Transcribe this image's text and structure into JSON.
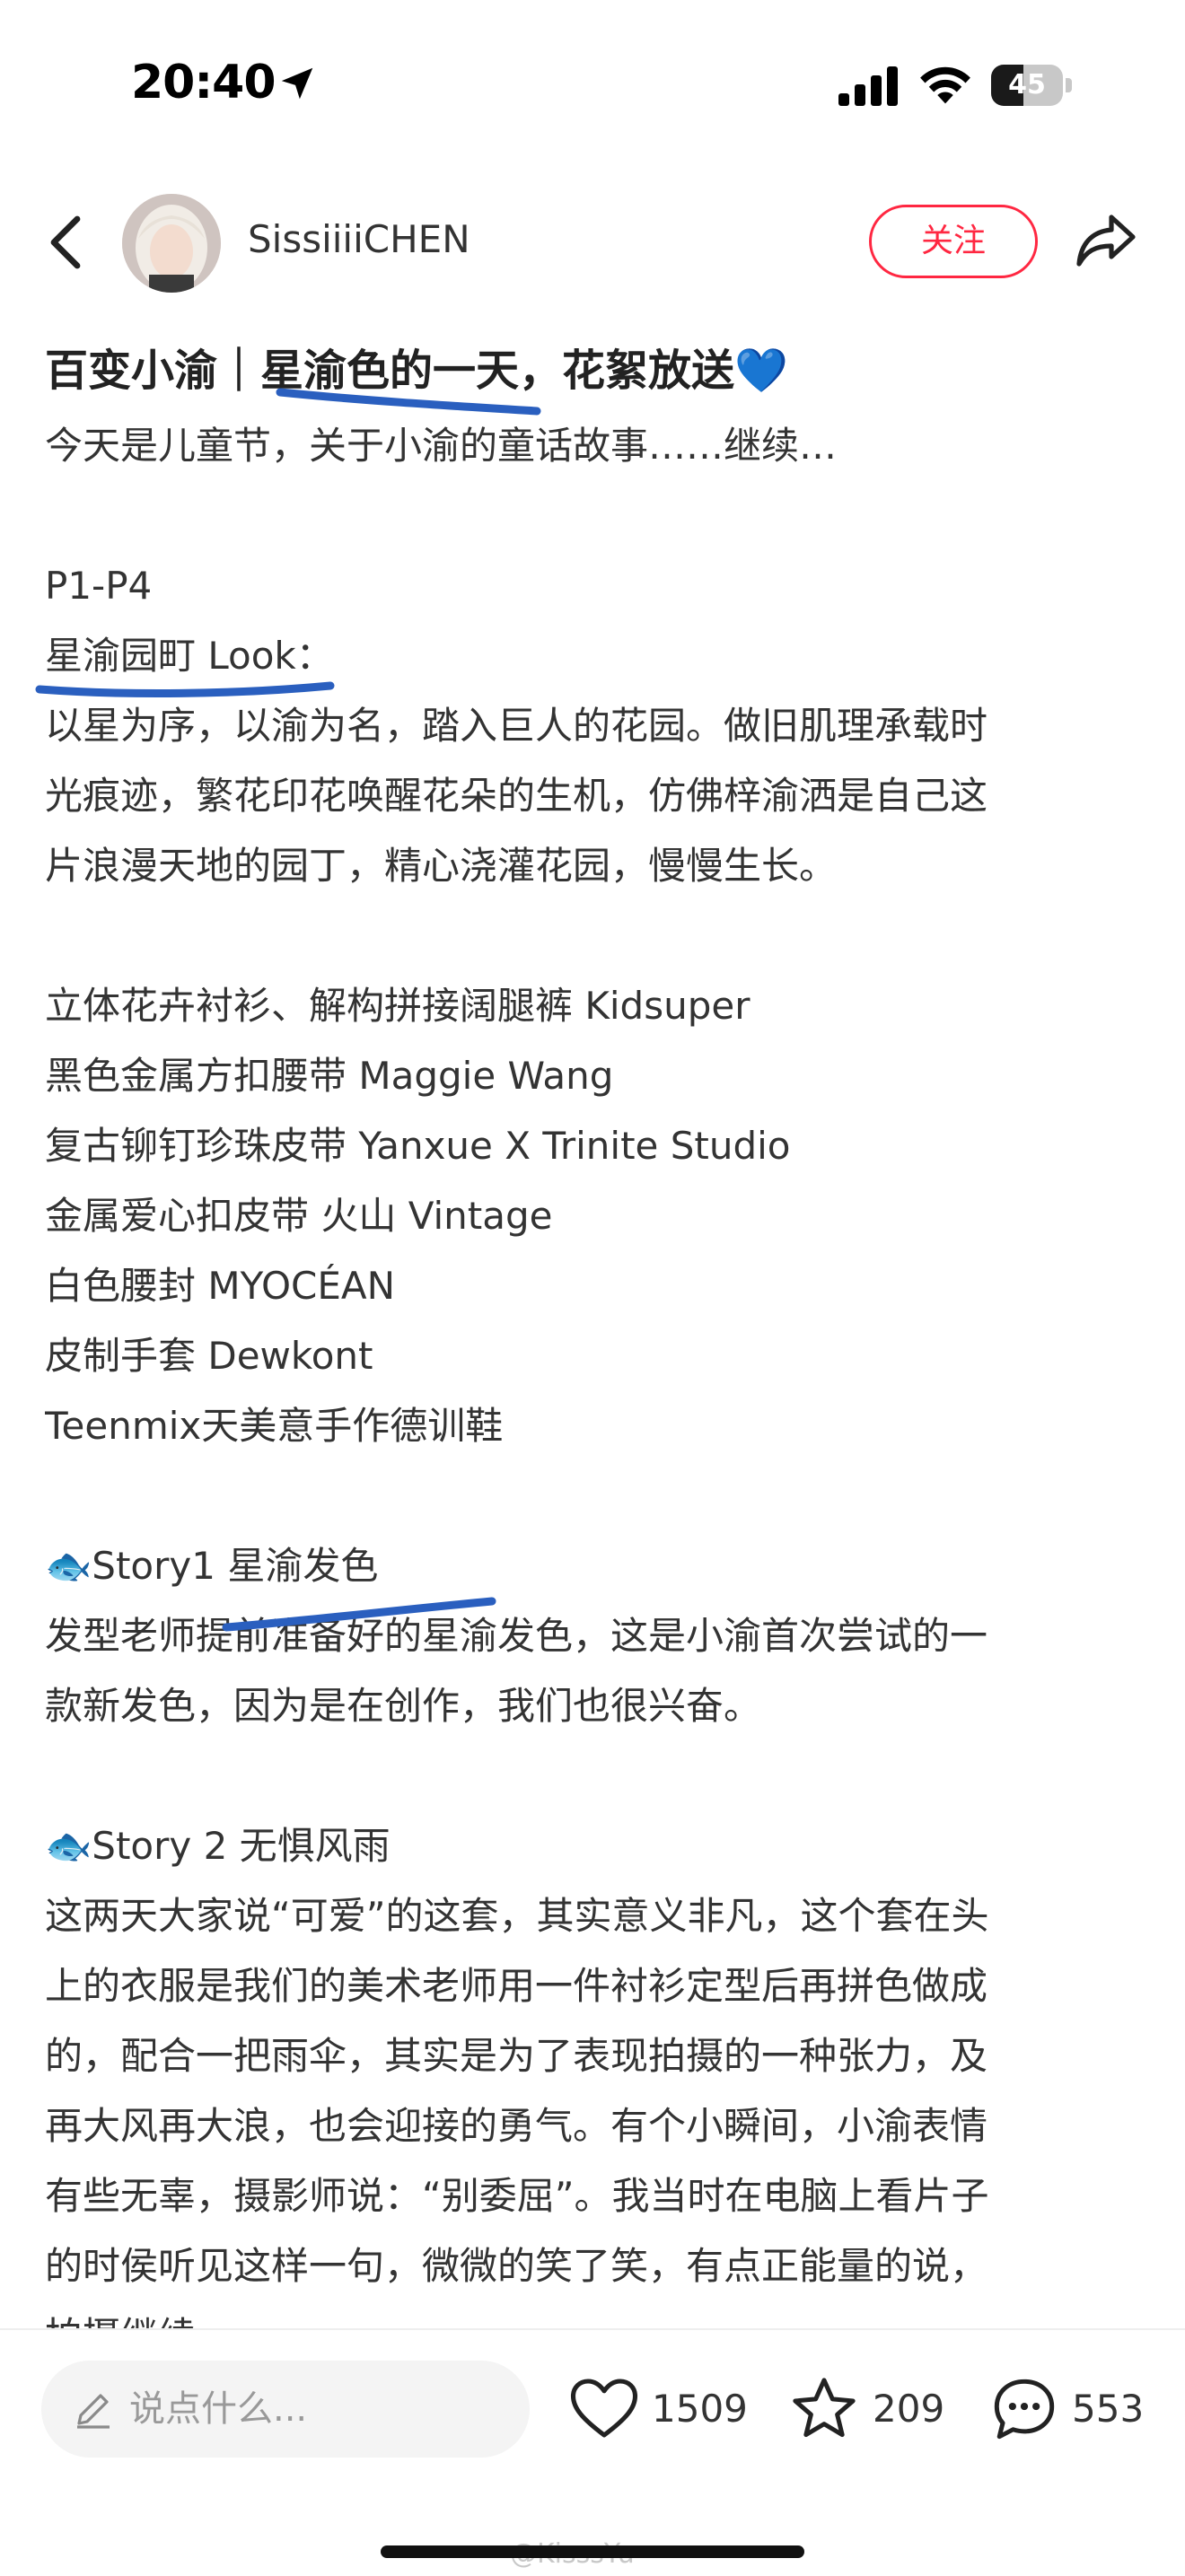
{
  "status_bar": {
    "time": "20:40",
    "battery": "45",
    "battery_level": 0.45
  },
  "header": {
    "username": "SissiiiiCHEN",
    "follow_label": "关注"
  },
  "post": {
    "title": "百变小渝｜星渝色的一天，花絮放送💙",
    "lines": [
      "今天是儿童节，关于小渝的童话故事……继续…",
      "",
      "P1-P4",
      "星渝园町 Look：",
      "以星为序，以渝为名，踏入巨人的花园。做旧肌理承载时",
      "光痕迹，繁花印花唤醒花朵的生机，仿佛梓渝洒是自己这",
      "片浪漫天地的园丁，精心浇灌花园，慢慢生长。",
      "",
      "立体花卉衬衫、解构拼接阔腿裤 Kidsuper",
      "黑色金属方扣腰带 Maggie Wang",
      "复古铆钉珍珠皮带 Yanxue X Trinite Studio",
      "金属爱心扣皮带 火山 Vintage",
      "白色腰封 MYOCÉAN",
      "皮制手套 Dewkont",
      "Teenmix天美意手作德训鞋",
      "",
      "🐟Story1 星渝发色",
      "发型老师提前准备好的星渝发色，这是小渝首次尝试的一",
      "款新发色，因为是在创作，我们也很兴奋。",
      "",
      "🐟Story 2 无惧风雨",
      "这两天大家说“可爱”的这套，其实意义非凡，这个套在头",
      "上的衣服是我们的美术老师用一件衬衫定型后再拼色做成",
      "的，配合一把雨伞，其实是为了表现拍摄的一种张力，及",
      "再大风再大浪，也会迎接的勇气。有个小瞬间，小渝表情",
      "有些无辜，摄影师说：“别委屈”。我当时在电脑上看片子",
      "的时侯听见这样一句，微微的笑了笑，有点正能量的说，",
      "拍摄继续"
    ]
  },
  "bottom_bar": {
    "comment_placeholder": "说点什么...",
    "likes": "1509",
    "collects": "209",
    "comments": "553",
    "watermark": "@KisssYu"
  },
  "colors": {
    "accent": "#ff2741",
    "annotation": "#2a5fbf"
  }
}
